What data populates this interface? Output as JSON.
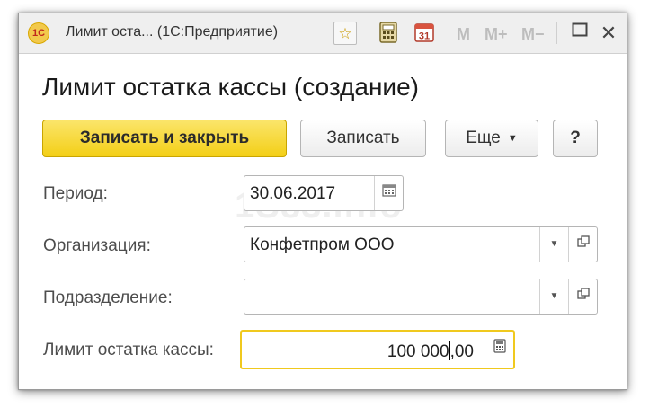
{
  "window": {
    "title": "Лимит оста...  (1С:Предприятие)",
    "logo_text": "1С",
    "toolbar": {
      "m": "M",
      "m_plus": "M+",
      "m_minus": "M−",
      "calendar_day": "31"
    }
  },
  "form": {
    "heading": "Лимит остатка кассы (создание)",
    "buttons": {
      "save_close": "Записать и закрыть",
      "save": "Записать",
      "more": "Еще",
      "help": "?"
    },
    "fields": {
      "period": {
        "label": "Период:",
        "value": "30.06.2017"
      },
      "organization": {
        "label": "Организация:",
        "value": "Конфетпром ООО"
      },
      "division": {
        "label": "Подразделение:",
        "value": ""
      },
      "cash_limit": {
        "label": "Лимит остатка кассы:",
        "value_before_cursor": "100 000",
        "value_after_cursor": ",00"
      }
    }
  },
  "watermark": "1S83.info",
  "colors": {
    "primary_button": "#f3cf17",
    "focus_border": "#f0c91e"
  }
}
